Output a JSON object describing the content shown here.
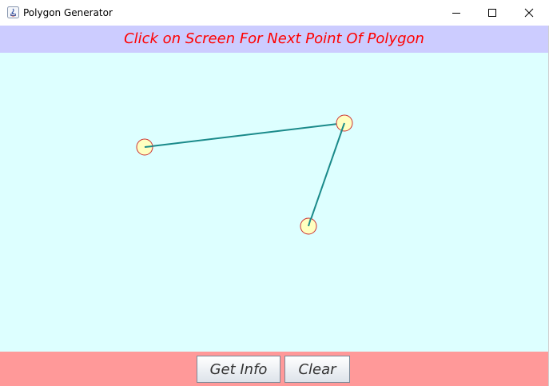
{
  "window": {
    "title": "Polygon Generator"
  },
  "icons": {
    "app": "java-icon",
    "minimize": "minimize-icon",
    "maximize": "maximize-icon",
    "close": "close-icon"
  },
  "banner": {
    "text": "Click on Screen For Next Point Of Polygon"
  },
  "buttons": {
    "get_info": "Get Info",
    "clear": "Clear"
  },
  "colors": {
    "banner_bg": "#ccccff",
    "banner_text": "#ff0000",
    "canvas_bg": "#ddffff",
    "bottom_bg": "#ff9999",
    "edge": "#1a8a8a",
    "vertex_fill": "#ffffc0",
    "vertex_stroke": "#cc3333"
  },
  "polygon": {
    "vertex_count": 3,
    "edge_count": 2
  }
}
